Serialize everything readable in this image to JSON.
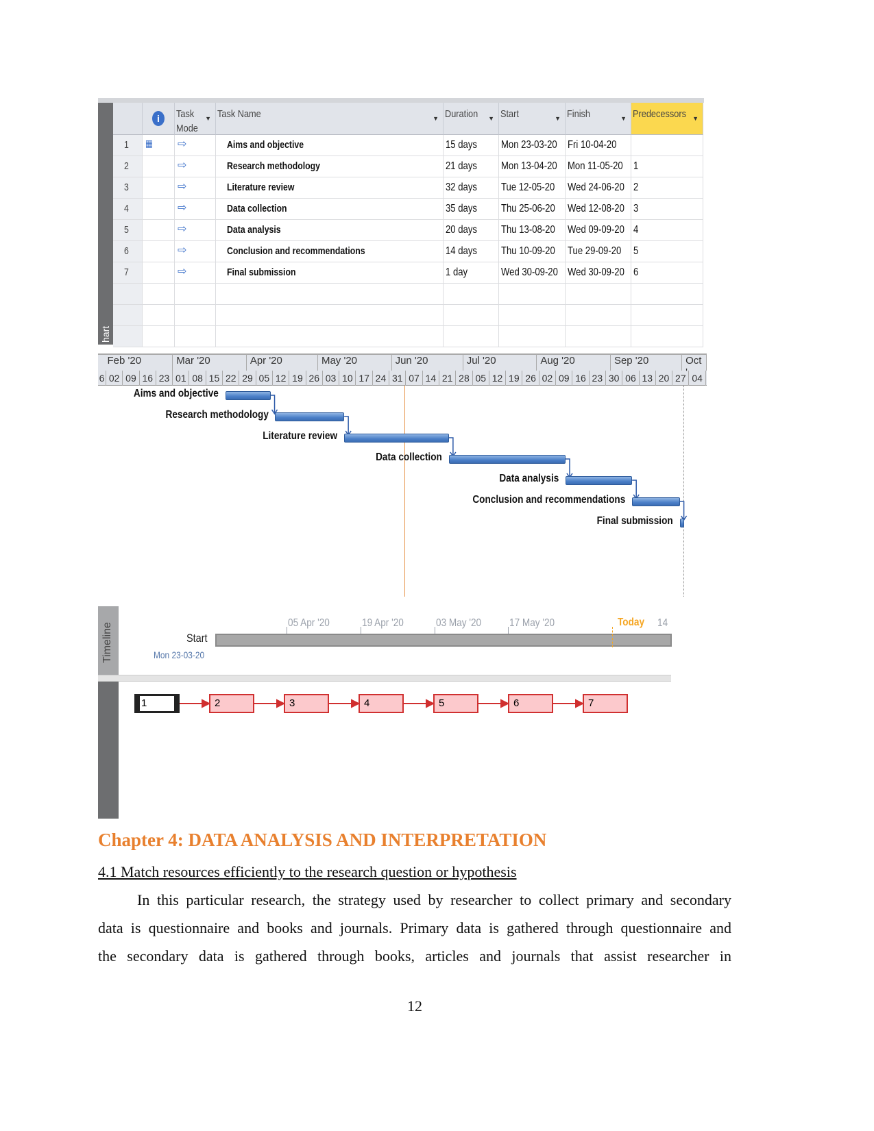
{
  "table": {
    "headers": {
      "task_mode": "Task Mode",
      "task_name": "Task Name",
      "duration": "Duration",
      "start": "Start",
      "finish": "Finish",
      "predecessors": "Predecessors"
    },
    "rows": [
      {
        "id": "1",
        "name": "Aims and objective",
        "duration": "15 days",
        "start": "Mon 23-03-20",
        "finish": "Fri 10-04-20",
        "pred": "",
        "s": "2020-03-23",
        "f": "2020-04-10"
      },
      {
        "id": "2",
        "name": "Research methodology",
        "duration": "21 days",
        "start": "Mon 13-04-20",
        "finish": "Mon 11-05-20",
        "pred": "1",
        "s": "2020-04-13",
        "f": "2020-05-11"
      },
      {
        "id": "3",
        "name": "Literature review",
        "duration": "32 days",
        "start": "Tue 12-05-20",
        "finish": "Wed 24-06-20",
        "pred": "2",
        "s": "2020-05-12",
        "f": "2020-06-24"
      },
      {
        "id": "4",
        "name": "Data collection",
        "duration": "35 days",
        "start": "Thu 25-06-20",
        "finish": "Wed 12-08-20",
        "pred": "3",
        "s": "2020-06-25",
        "f": "2020-08-12"
      },
      {
        "id": "5",
        "name": "Data analysis",
        "duration": "20 days",
        "start": "Thu 13-08-20",
        "finish": "Wed 09-09-20",
        "pred": "4",
        "s": "2020-08-13",
        "f": "2020-09-09"
      },
      {
        "id": "6",
        "name": "Conclusion and recommendations",
        "duration": "14 days",
        "start": "Thu 10-09-20",
        "finish": "Tue 29-09-20",
        "pred": "5",
        "s": "2020-09-10",
        "f": "2020-09-29"
      },
      {
        "id": "7",
        "name": "Final submission",
        "duration": "1 day",
        "start": "Wed 30-09-20",
        "finish": "Wed 30-09-20",
        "pred": "6",
        "s": "2020-09-30",
        "f": "2020-09-30"
      }
    ]
  },
  "side_label_chart": "hart",
  "gantt": {
    "months": [
      "Feb '20",
      "Mar '20",
      "Apr '20",
      "May '20",
      "Jun '20",
      "Jul '20",
      "Aug '20",
      "Sep '20",
      "Oct '"
    ],
    "days": [
      "6",
      "02",
      "09",
      "16",
      "23",
      "01",
      "08",
      "15",
      "22",
      "29",
      "05",
      "12",
      "19",
      "26",
      "03",
      "10",
      "17",
      "24",
      "31",
      "07",
      "14",
      "21",
      "28",
      "05",
      "12",
      "19",
      "26",
      "02",
      "09",
      "16",
      "23",
      "30",
      "06",
      "13",
      "20",
      "27",
      "04"
    ],
    "bar_color": "#4a7fc8"
  },
  "timeline": {
    "side_label": "Timeline",
    "start_label": "Start",
    "start_date": "Mon 23-03-20",
    "ticks": [
      "05 Apr '20",
      "19 Apr '20",
      "03 May '20",
      "17 May '20"
    ],
    "today": "Today",
    "end_tick": "14",
    "today_color": "#f5a623"
  },
  "network": {
    "nodes": [
      "1",
      "2",
      "3",
      "4",
      "5",
      "6",
      "7"
    ],
    "color": "#d03030"
  },
  "doc": {
    "heading": "Chapter 4: DATA ANALYSIS AND INTERPRETATION",
    "heading_color": "#e8802e",
    "subheading": "4.1 Match resources efficiently to the research question or hypothesis",
    "lines": [
      "In this particular research, the strategy used by researcher to collect primary and secondary",
      "data is questionnaire and books and journals. Primary data is gathered through questionnaire and",
      "the secondary data is gathered through books, articles and journals that assist researcher in"
    ],
    "page_number": "12"
  }
}
